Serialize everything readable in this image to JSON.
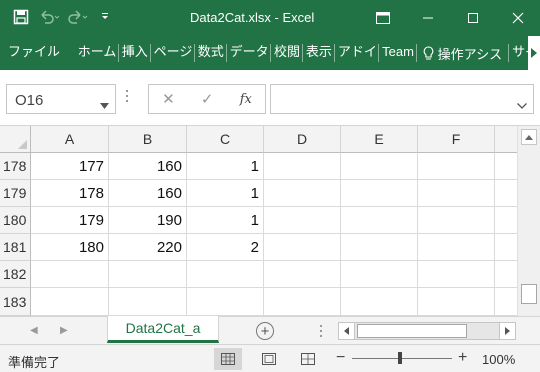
{
  "window": {
    "title": "Data2Cat.xlsx - Excel",
    "controls": [
      "ribbon-display-options",
      "minimize",
      "maximize",
      "close"
    ]
  },
  "colors": {
    "brand": "#217346",
    "header_bg": "#f3f3f3",
    "gridline": "#dadada"
  },
  "ribbon": {
    "tabs": [
      "ファイル",
      "ホーム",
      "挿入",
      "ページ",
      "数式",
      "データ",
      "校閲",
      "表示",
      "アドイ",
      "Team"
    ],
    "tell_me": "操作アシス",
    "overflow_tab": "サイ"
  },
  "formula_bar": {
    "name_box": "O16",
    "cancel_icon": "✕",
    "enter_icon": "✓",
    "fx_label": "fx",
    "formula": ""
  },
  "grid": {
    "columns": [
      "A",
      "B",
      "C",
      "D",
      "E",
      "F"
    ],
    "rows": [
      {
        "num": "178",
        "cells": [
          "177",
          "160",
          "1",
          "",
          "",
          ""
        ]
      },
      {
        "num": "179",
        "cells": [
          "178",
          "160",
          "1",
          "",
          "",
          ""
        ]
      },
      {
        "num": "180",
        "cells": [
          "179",
          "190",
          "1",
          "",
          "",
          ""
        ]
      },
      {
        "num": "181",
        "cells": [
          "180",
          "220",
          "2",
          "",
          "",
          ""
        ]
      },
      {
        "num": "182",
        "cells": [
          "",
          "",
          "",
          "",
          "",
          ""
        ]
      },
      {
        "num": "183",
        "cells": [
          "",
          "",
          "",
          "",
          "",
          ""
        ]
      }
    ]
  },
  "sheets": {
    "active": "Data2Cat_a"
  },
  "status": {
    "ready": "準備完了",
    "zoom": "100%",
    "zoom_minus": "−",
    "zoom_plus": "+"
  }
}
